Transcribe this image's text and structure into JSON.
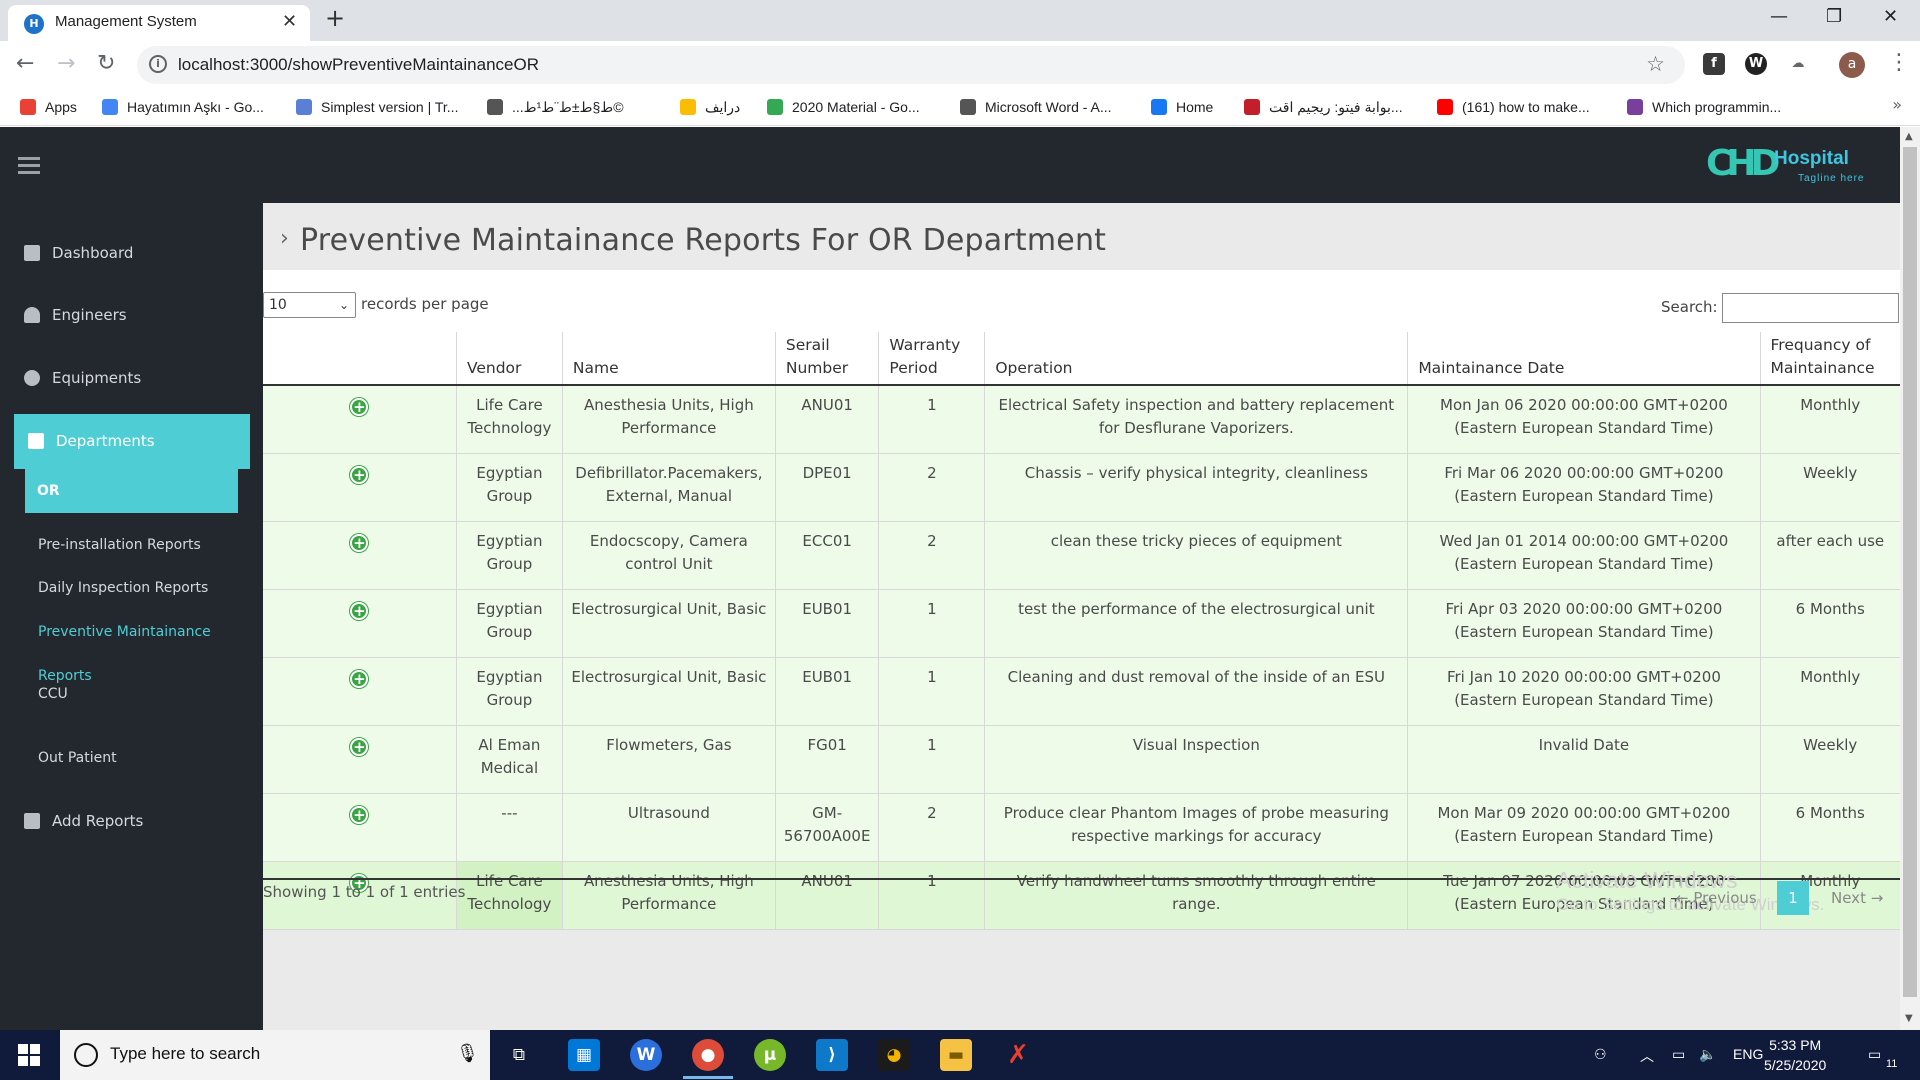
{
  "browser": {
    "tab_title": "Management System",
    "url": "localhost:3000/showPreventiveMaintainanceOR",
    "avatar_letter": "a",
    "bookmarks": [
      {
        "label": "Apps",
        "color": "#e94235"
      },
      {
        "label": "Hayatımın Aşkı - Go...",
        "color": "#4285f4"
      },
      {
        "label": "Simplest version | Tr...",
        "color": "#5b7fd6"
      },
      {
        "label": "...ط§ط±ط¨ط¹ط©",
        "color": "#555555"
      },
      {
        "label": "درايف",
        "color": "#fbbc04"
      },
      {
        "label": "2020 Material - Go...",
        "color": "#34a853"
      },
      {
        "label": "Microsoft Word - A...",
        "color": "#555555"
      },
      {
        "label": "Home",
        "color": "#1877f2"
      },
      {
        "label": "بوابة فيتو: ريجيم اقت...",
        "color": "#c41e2a"
      },
      {
        "label": "(161) how to make...",
        "color": "#ff0000"
      },
      {
        "label": "Which programmin...",
        "color": "#7a3e9d"
      }
    ]
  },
  "app": {
    "logo_text": "Hospital",
    "logo_tagline": "Tagline here",
    "sidebar": {
      "dashboard": "Dashboard",
      "engineers": "Engineers",
      "equipments": "Equipments",
      "departments": "Departments",
      "or": "OR",
      "pre_installation": "Pre-installation Reports",
      "daily_inspection": "Daily Inspection Reports",
      "preventive": "Preventive Maintainance",
      "reports": "Reports",
      "ccu": "CCU",
      "out_patient": "Out Patient",
      "add_reports": "Add Reports"
    },
    "page_title": "Preventive Maintainance Reports For OR Department",
    "length_value": "10",
    "length_label": "records per page",
    "search_label": "Search:",
    "table": {
      "headers": [
        "",
        "Vendor",
        "Name",
        "Serail Number",
        "Warranty Period",
        "Operation",
        "Maintainance Date",
        "Frequancy of Maintainance"
      ],
      "rows": [
        {
          "vendor": "Life Care Technology",
          "name": "Anesthesia Units, High Performance",
          "serial": "ANU01",
          "warranty": "1",
          "operation": "Electrical Safety inspection and battery replacement for Desflurane Vaporizers.",
          "date": "Mon Jan 06 2020 00:00:00 GMT+0200 (Eastern European Standard Time)",
          "frequency": "Monthly"
        },
        {
          "vendor": "Egyptian Group",
          "name": "Defibrillator.Pacemakers, External, Manual",
          "serial": "DPE01",
          "warranty": "2",
          "operation": "Chassis – verify physical integrity, cleanliness",
          "date": "Fri Mar 06 2020 00:00:00 GMT+0200 (Eastern European Standard Time)",
          "frequency": "Weekly"
        },
        {
          "vendor": "Egyptian Group",
          "name": "Endocscopy, Camera control Unit",
          "serial": "ECC01",
          "warranty": "2",
          "operation": "clean these tricky pieces of equipment",
          "date": "Wed Jan 01 2014 00:00:00 GMT+0200 (Eastern European Standard Time)",
          "frequency": "after each use"
        },
        {
          "vendor": "Egyptian Group",
          "name": "Electrosurgical Unit, Basic",
          "serial": "EUB01",
          "warranty": "1",
          "operation": "test the performance of the electrosurgical unit",
          "date": "Fri Apr 03 2020 00:00:00 GMT+0200 (Eastern European Standard Time)",
          "frequency": "6 Months"
        },
        {
          "vendor": "Egyptian Group",
          "name": "Electrosurgical Unit, Basic",
          "serial": "EUB01",
          "warranty": "1",
          "operation": "Cleaning and dust removal of the inside of an ESU",
          "date": "Fri Jan 10 2020 00:00:00 GMT+0200 (Eastern European Standard Time)",
          "frequency": "Monthly"
        },
        {
          "vendor": "Al Eman Medical",
          "name": "Flowmeters, Gas",
          "serial": "FG01",
          "warranty": "1",
          "operation": "Visual Inspection",
          "date": "Invalid Date",
          "frequency": "Weekly"
        },
        {
          "vendor": "---",
          "name": "Ultrasound",
          "serial": "GM-56700A00E",
          "warranty": "2",
          "operation": "Produce clear Phantom Images of probe measuring respective markings for accuracy",
          "date": "Mon Mar 09 2020 00:00:00 GMT+0200 (Eastern European Standard Time)",
          "frequency": "6 Months"
        },
        {
          "vendor": "Life Care Technology",
          "name": "Anesthesia Units, High Performance",
          "serial": "ANU01",
          "warranty": "1",
          "operation": "Verify handwheel turns smoothly through entire range.",
          "date": "Tue Jan 07 2020 00:00:00 GMT+0200 (Eastern European Standard Time)",
          "frequency": "Monthly"
        }
      ]
    },
    "info_text": "Showing 1 to 1 of 1 entries",
    "pagination": {
      "previous": "← Previous",
      "current": "1",
      "next": "Next →"
    },
    "watermark": {
      "line1": "Activate Windows",
      "line2": "Go to Settings to activate Windows."
    }
  },
  "taskbar": {
    "search_placeholder": "Type here to search",
    "language": "ENG",
    "time": "5:33 PM",
    "date": "5/25/2020",
    "notifications": "11"
  }
}
